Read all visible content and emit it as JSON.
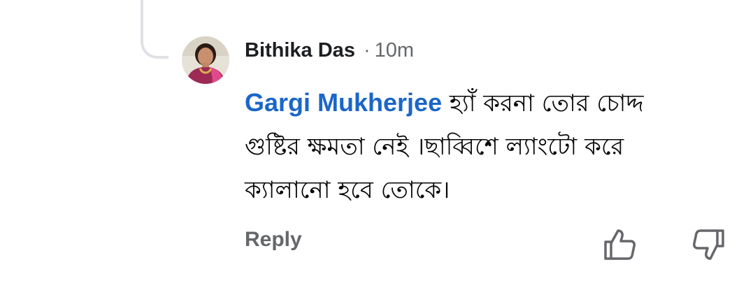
{
  "comment": {
    "author": "Bithika Das",
    "separator": "·",
    "time": "10m",
    "mention": "Gargi Mukherjee",
    "text": " হ্যাঁ করনা তোর চোদ্দ গুষ্টির ক্ষমতা নেই ।ছাব্বিশে ল্যাংটো করে ক্যালানো হবে তোকে।",
    "avatar_icon": "profile-photo"
  },
  "actions": {
    "reply_label": "Reply",
    "like_icon": "thumbs-up-icon",
    "dislike_icon": "thumbs-down-icon"
  },
  "colors": {
    "mention": "#1b66c9",
    "author": "#1c1e21",
    "muted": "#65676b",
    "thread_line": "#dfe1e5"
  }
}
